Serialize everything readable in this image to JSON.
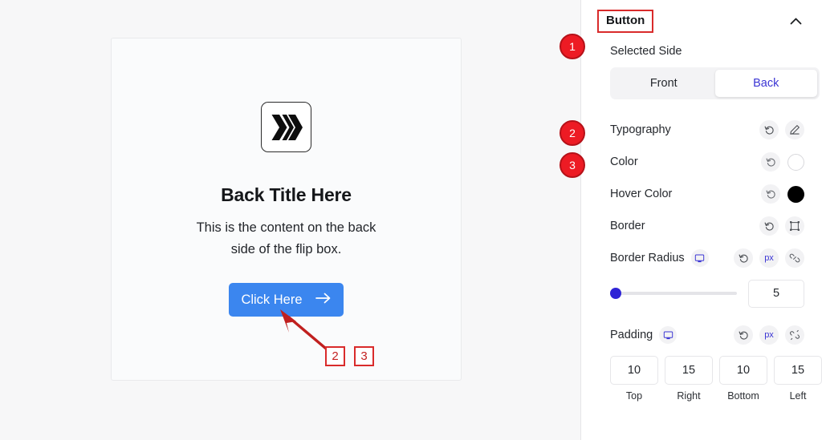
{
  "preview": {
    "card": {
      "logo_icon": "hive-diamond-chevrons-icon",
      "title": "Back Title Here",
      "body": "This is the content on the back side of the flip box.",
      "button_label": "Click Here",
      "button_arrow_icon": "arrow-right-icon",
      "button_color": "#3b86ef"
    },
    "annotations": {
      "arrow_icon": "pointer-arrow-icon",
      "boxes": [
        {
          "label": "2"
        },
        {
          "label": "3"
        }
      ],
      "accent_color": "#d92b2b"
    }
  },
  "settings": {
    "header": {
      "title": "Button",
      "collapse_icon": "chevron-up-icon",
      "highlight_color": "#d92b2b"
    },
    "badges": [
      {
        "label": "1"
      },
      {
        "label": "2"
      },
      {
        "label": "3"
      }
    ],
    "selected_side": {
      "label": "Selected Side",
      "options": [
        {
          "label": "Front",
          "active": false
        },
        {
          "label": "Back",
          "active": true
        }
      ],
      "active_color": "#3b35d4"
    },
    "typography": {
      "label": "Typography",
      "reset_icon": "reset-icon",
      "edit_icon": "pencil-edit-icon"
    },
    "color": {
      "label": "Color",
      "reset_icon": "reset-icon",
      "swatch_icon": "color-swatch-icon",
      "value": "#ffffff"
    },
    "hover_color": {
      "label": "Hover Color",
      "reset_icon": "reset-icon",
      "swatch_icon": "color-swatch-icon",
      "value": "#000000"
    },
    "border": {
      "label": "Border",
      "reset_icon": "reset-icon",
      "border_icon": "border-box-icon"
    },
    "border_radius": {
      "label": "Border Radius",
      "device_icon": "monitor-desktop-icon",
      "reset_icon": "reset-icon",
      "unit": "px",
      "link_icon": "link-chain-icon",
      "value": "5",
      "slider_percent": 0
    },
    "padding": {
      "label": "Padding",
      "device_icon": "monitor-desktop-icon",
      "reset_icon": "reset-icon",
      "unit": "px",
      "link_icon": "broken-link-chain-icon",
      "fields": [
        {
          "value": "10",
          "label": "Top"
        },
        {
          "value": "15",
          "label": "Right"
        },
        {
          "value": "10",
          "label": "Bottom"
        },
        {
          "value": "15",
          "label": "Left"
        }
      ]
    }
  }
}
